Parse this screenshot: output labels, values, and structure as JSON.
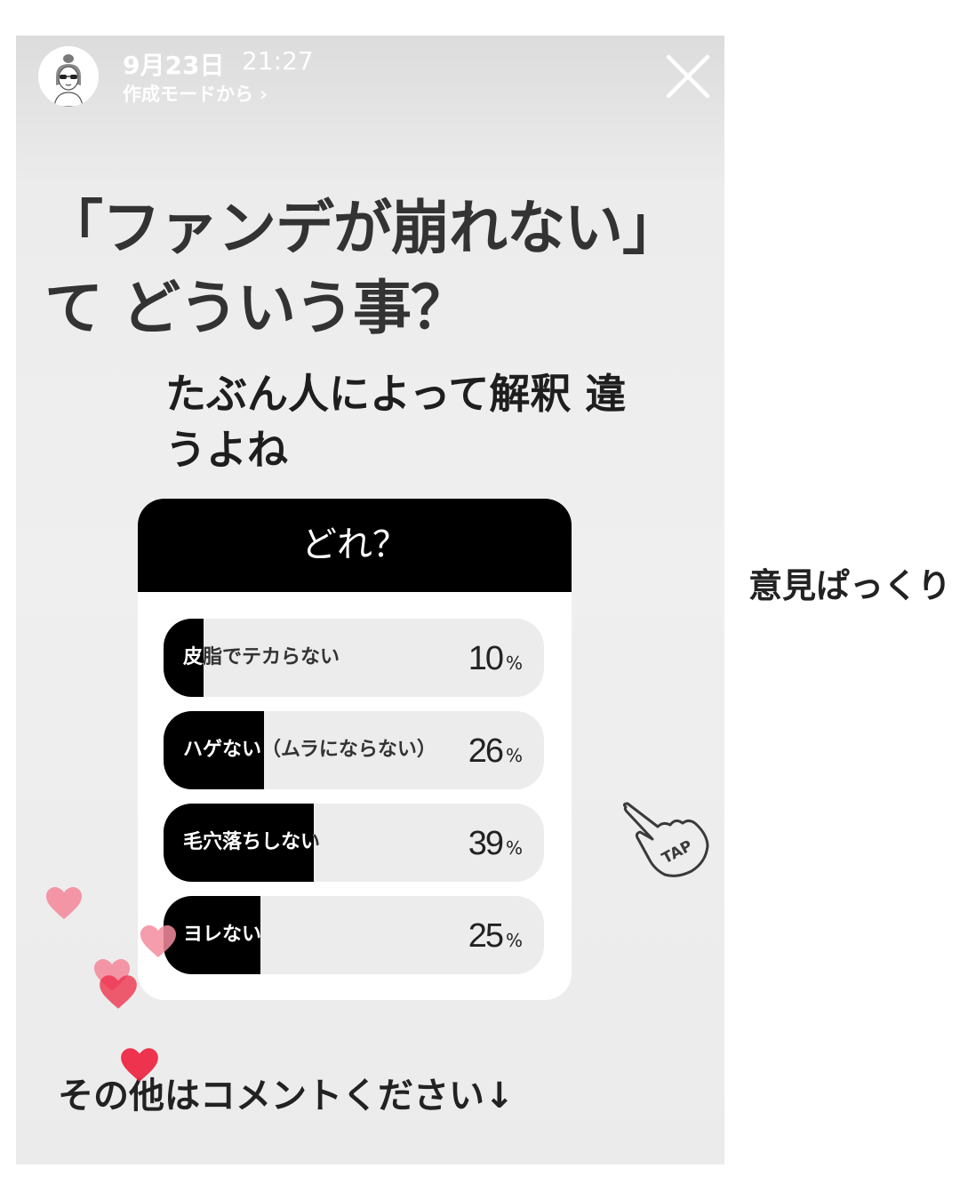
{
  "story": {
    "date": "9月23日",
    "time": "21:27",
    "subtitle": "作成モードから ›",
    "headline": "「ファンデが崩れない」て どういう事？",
    "subhead": "たぶん人によって解釈 違うよね",
    "footer_text": "その他はコメントください↓"
  },
  "poll": {
    "question": "どれ？",
    "options": [
      {
        "label": "皮脂でテカらない",
        "percent": 10,
        "percent_text": "10",
        "percent_sign": "%"
      },
      {
        "label": "ハゲない（ムラにならない）",
        "percent": 26,
        "percent_text": "26",
        "percent_sign": "%"
      },
      {
        "label": "毛穴落ちしない",
        "percent": 39,
        "percent_text": "39",
        "percent_sign": "%"
      },
      {
        "label": "ヨレない",
        "percent": 25,
        "percent_text": "25",
        "percent_sign": "%"
      }
    ]
  },
  "caption": "意見ぱっくり",
  "icons": {
    "close": "close-icon",
    "avatar": "avatar",
    "tap": "tap-sticker-icon",
    "reaction": "heart-icon"
  },
  "colors": {
    "poll_fill": "#000000",
    "poll_track": "#ececec",
    "heart_pink": "#f48c9e",
    "heart_red": "#ee2a45"
  }
}
